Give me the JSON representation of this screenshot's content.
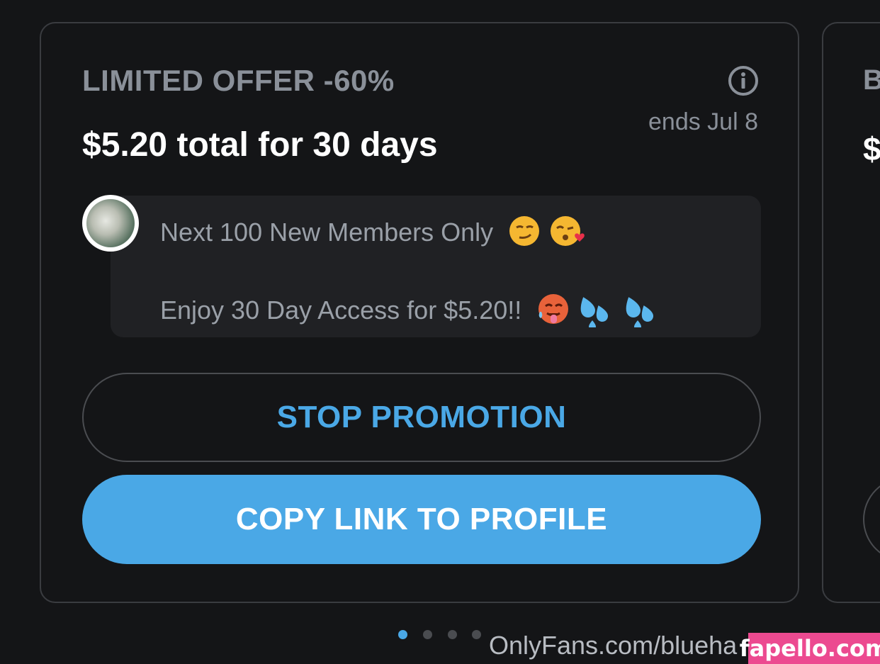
{
  "offer": {
    "title": "LIMITED OFFER -60%",
    "ends": "ends Jul 8",
    "price_line": "$5.20 total for 30 days",
    "message_line_1": "Next 100 New Members Only",
    "message_line_2": "Enjoy 30 Day Access for $5.20!!",
    "stop_button": "STOP PROMOTION",
    "copy_button": "COPY LINK TO PROFILE"
  },
  "next_card": {
    "title_partial": "B",
    "price_partial": "$"
  },
  "carousel": {
    "page_count": 4,
    "active_index": 0
  },
  "footer": {
    "url_text": "OnlyFans.com/blueha"
  },
  "watermark": {
    "text": "fapello.com"
  },
  "colors": {
    "accent": "#4aa8e6",
    "background": "#141517",
    "card_border": "#3a3c40",
    "muted_text": "#8a9099",
    "watermark_bg": "#ec4a90"
  },
  "icons": [
    "info-icon",
    "smirk-emoji",
    "kiss-emoji",
    "hot-face-emoji",
    "sweat-droplets-emoji"
  ]
}
